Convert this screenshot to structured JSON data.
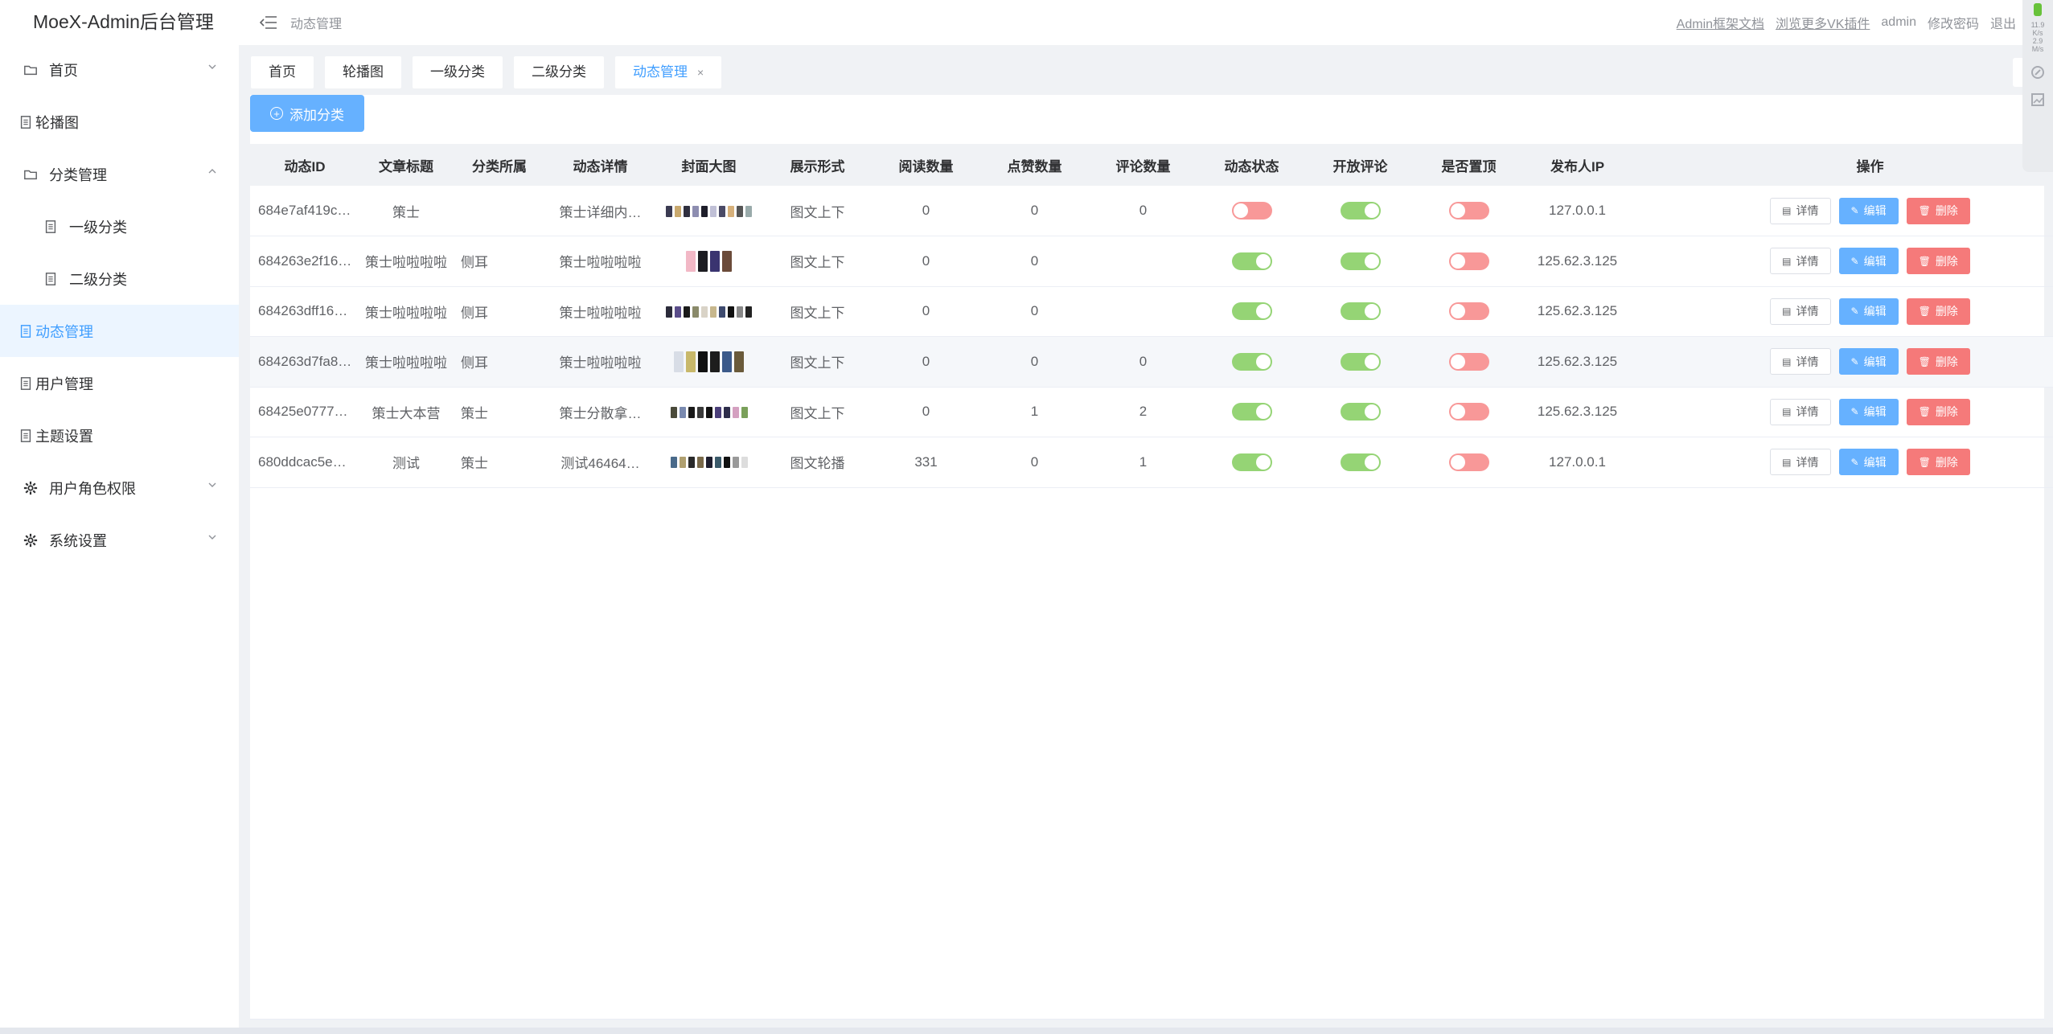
{
  "app": {
    "title": "MoeX-Admin后台管理"
  },
  "sidebar": {
    "items": [
      {
        "label": "首页"
      },
      {
        "label": "轮播图"
      },
      {
        "label": "分类管理"
      },
      {
        "label": "一级分类"
      },
      {
        "label": "二级分类"
      },
      {
        "label": "动态管理"
      },
      {
        "label": "用户管理"
      },
      {
        "label": "主题设置"
      },
      {
        "label": "用户角色权限"
      },
      {
        "label": "系统设置"
      }
    ]
  },
  "header": {
    "breadcrumb": "动态管理",
    "links": {
      "docs": "Admin框架文档",
      "plugins": "浏览更多VK插件",
      "user": "admin",
      "change_password": "修改密码",
      "logout": "退出"
    }
  },
  "tags": [
    {
      "label": "首页"
    },
    {
      "label": "轮播图"
    },
    {
      "label": "一级分类"
    },
    {
      "label": "二级分类"
    },
    {
      "label": "动态管理",
      "close": "×"
    }
  ],
  "toolbar": {
    "add_label": "添加分类",
    "add_icon": "⊕"
  },
  "table": {
    "columns": [
      "动态ID",
      "文章标题",
      "分类所属",
      "动态详情",
      "封面大图",
      "展示形式",
      "阅读数量",
      "点赞数量",
      "评论数量",
      "动态状态",
      "开放评论",
      "是否置顶",
      "发布人IP",
      "操作"
    ],
    "buttons": {
      "detail": "详情",
      "edit": "编辑",
      "delete": "删除"
    },
    "rows": [
      {
        "id": "684e7af419c…",
        "title": "策士",
        "category": "",
        "detail": "策士详细内…",
        "display": "图文上下",
        "reads": "0",
        "likes": "0",
        "comments": "0",
        "status": false,
        "open_comment": true,
        "pinned": false,
        "ip": "127.0.0.1",
        "thumbs": [
          "#3b3b52",
          "#c9a96e",
          "#2f2f3f",
          "#8d8db0",
          "#1e1e2a",
          "#c0c0d6",
          "#4a4a66",
          "#d6b07a",
          "#555",
          "#9aa"
        ]
      },
      {
        "id": "684263e2f16…",
        "title": "策士啦啦啦啦",
        "category": "侧耳",
        "detail": "策士啦啦啦啦",
        "display": "图文上下",
        "reads": "0",
        "likes": "0",
        "comments": "",
        "status": true,
        "open_comment": true,
        "pinned": false,
        "ip": "125.62.3.125",
        "thumbs": [
          "#f2b8c6",
          "#1d1d22",
          "#3a3470",
          "#6b4b3a"
        ]
      },
      {
        "id": "684263dff16…",
        "title": "策士啦啦啦啦",
        "category": "侧耳",
        "detail": "策士啦啦啦啦",
        "display": "图文上下",
        "reads": "0",
        "likes": "0",
        "comments": "",
        "status": true,
        "open_comment": true,
        "pinned": false,
        "ip": "125.62.3.125",
        "thumbs": [
          "#2b2b3a",
          "#5a4d8a",
          "#1a1a1a",
          "#8a8a6a",
          "#d9d3c7",
          "#c7b78d",
          "#3d4a6e",
          "#111",
          "#888",
          "#222"
        ]
      },
      {
        "id": "684263d7fa8…",
        "title": "策士啦啦啦啦",
        "category": "侧耳",
        "detail": "策士啦啦啦啦",
        "display": "图文上下",
        "reads": "0",
        "likes": "0",
        "comments": "0",
        "status": true,
        "open_comment": true,
        "pinned": false,
        "ip": "125.62.3.125",
        "thumbs": [
          "#d8dde6",
          "#c8b86a",
          "#111",
          "#1d1d1d",
          "#3c5a8a",
          "#6a5a3a"
        ]
      },
      {
        "id": "68425e0777…",
        "title": "策士大本营",
        "category": "策士",
        "detail": "策士分散拿…",
        "display": "图文上下",
        "reads": "0",
        "likes": "1",
        "comments": "2",
        "status": true,
        "open_comment": true,
        "pinned": false,
        "ip": "125.62.3.125",
        "thumbs": [
          "#4a4a3a",
          "#7a8ab0",
          "#1a1a1a",
          "#3a3a3a",
          "#111",
          "#4b3f7a",
          "#2d2d4a",
          "#d4a0c0",
          "#7aa05a"
        ]
      },
      {
        "id": "680ddcac5e…",
        "title": "测试",
        "category": "策士",
        "detail": "测试46464…",
        "display": "图文轮播",
        "reads": "331",
        "likes": "0",
        "comments": "1",
        "status": true,
        "open_comment": true,
        "pinned": false,
        "ip": "127.0.0.1",
        "thumbs": [
          "#4a6a8a",
          "#b0a070",
          "#2a2a2a",
          "#7a6a4a",
          "#1e1e2e",
          "#3a5a6a",
          "#111",
          "#999",
          "#ddd"
        ]
      }
    ]
  },
  "widget": {
    "speed_up": "11.9",
    "unit_up": "K/s",
    "speed_down": "2.9",
    "unit_down": "M/s"
  },
  "colors": {
    "accent": "#409eff",
    "switch_on": "#95d475",
    "switch_off": "#f89898",
    "danger": "#f56c6c"
  }
}
